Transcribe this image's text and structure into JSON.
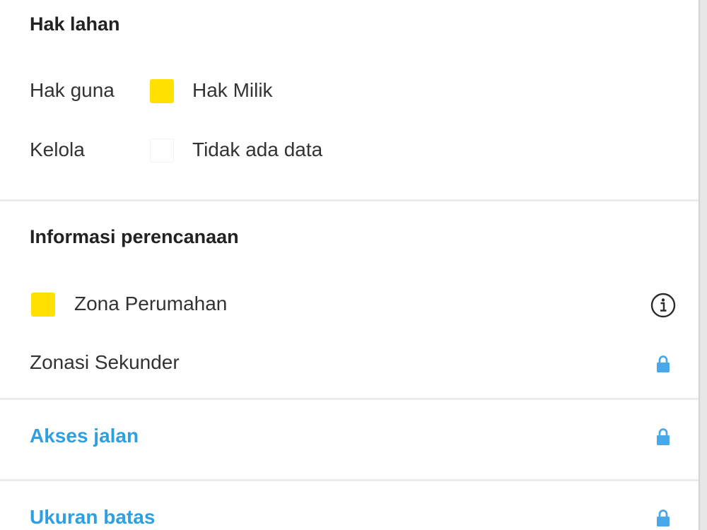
{
  "land_rights": {
    "heading": "Hak lahan",
    "rows": [
      {
        "label": "Hak guna",
        "value": "Hak Milik",
        "swatch_color": "#FFE000"
      },
      {
        "label": "Kelola",
        "value": "Tidak ada data",
        "swatch_color": "#FFFFFF"
      }
    ]
  },
  "planning_info": {
    "heading": "Informasi perencanaan",
    "zone": {
      "label": "Zona Perumahan",
      "swatch_color": "#FFE000",
      "icon": "info-icon"
    },
    "secondary_zoning": {
      "label": "Zonasi Sekunder",
      "icon": "lock-icon"
    }
  },
  "sections": [
    {
      "label": "Akses jalan",
      "icon": "lock-icon"
    },
    {
      "label": "Ukuran batas",
      "icon": "lock-icon"
    }
  ],
  "colors": {
    "accent": "#2E9FE0",
    "lock": "#4AA8E8",
    "zone_yellow": "#FFE000"
  }
}
